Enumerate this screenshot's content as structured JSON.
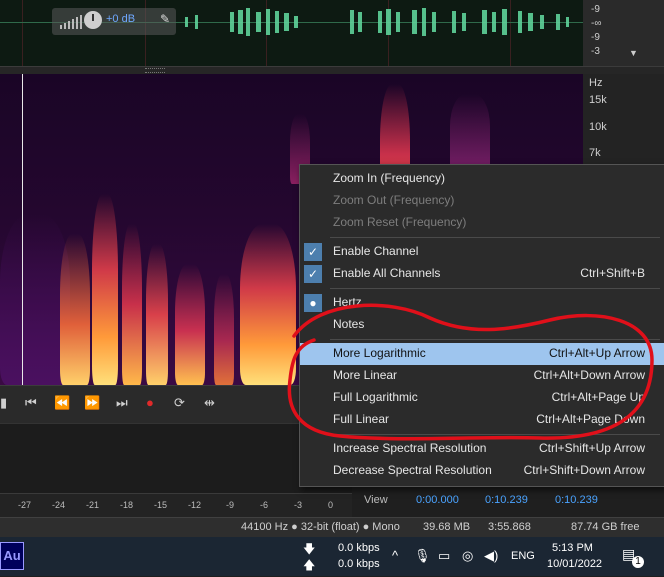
{
  "waveform": {
    "volume_label": "+0 dB",
    "db_ticks": [
      "-9",
      "-∞",
      "-9",
      "-3"
    ]
  },
  "hz_ruler": {
    "unit": "Hz",
    "ticks": [
      "15k",
      "10k",
      "7k"
    ]
  },
  "level_meter": {
    "ticks": [
      "-27",
      "-24",
      "-21",
      "-18",
      "-15",
      "-12",
      "-9",
      "-6",
      "-3",
      "0"
    ]
  },
  "view_panel": {
    "label": "View",
    "start": "0:00.000",
    "end": "0:10.239",
    "duration": "0:10.239"
  },
  "status_bar": {
    "format": "44100 Hz ● 32-bit (float) ● Mono",
    "file_size": "39.68 MB",
    "duration": "3:55.868",
    "free_space": "87.74 GB free"
  },
  "taskbar": {
    "app_icon_label": "Au",
    "download_speed": "0.0 kbps",
    "upload_speed": "0.0 kbps",
    "language": "ENG",
    "time": "5:13 PM",
    "date": "10/01/2022",
    "notification_count": "1"
  },
  "context_menu": {
    "items": [
      {
        "label": "Zoom In (Frequency)",
        "shortcut": ""
      },
      {
        "label": "Zoom Out (Frequency)",
        "shortcut": ""
      },
      {
        "label": "Zoom Reset (Frequency)",
        "shortcut": ""
      },
      {
        "label": "Enable Channel",
        "shortcut": ""
      },
      {
        "label": "Enable All Channels",
        "shortcut": "Ctrl+Shift+B"
      },
      {
        "label": "Hertz",
        "shortcut": ""
      },
      {
        "label": "Notes",
        "shortcut": ""
      },
      {
        "label": "More Logarithmic",
        "shortcut": "Ctrl+Alt+Up Arrow"
      },
      {
        "label": "More Linear",
        "shortcut": "Ctrl+Alt+Down Arrow"
      },
      {
        "label": "Full Logarithmic",
        "shortcut": "Ctrl+Alt+Page Up"
      },
      {
        "label": "Full Linear",
        "shortcut": "Ctrl+Alt+Page Down"
      },
      {
        "label": "Increase Spectral Resolution",
        "shortcut": "Ctrl+Shift+Up Arrow"
      },
      {
        "label": "Decrease Spectral Resolution",
        "shortcut": "Ctrl+Shift+Down Arrow"
      }
    ]
  },
  "colors": {
    "accent_blue": "#4aa3ff",
    "menu_highlight": "#9ec5ee",
    "annotation_red": "#e0101a",
    "record_red": "#e02a2a"
  },
  "icons": [
    "volume-knob-icon",
    "pin-icon",
    "go-to-start-icon",
    "rewind-icon",
    "fast-forward-icon",
    "go-to-end-icon",
    "record-icon",
    "loop-icon",
    "skip-selection-icon",
    "check-icon",
    "radio-dot-icon",
    "network-icon",
    "chevron-up-icon",
    "microphone-icon",
    "battery-icon",
    "globe-icon",
    "touch-icon",
    "speaker-icon",
    "notification-icon"
  ]
}
